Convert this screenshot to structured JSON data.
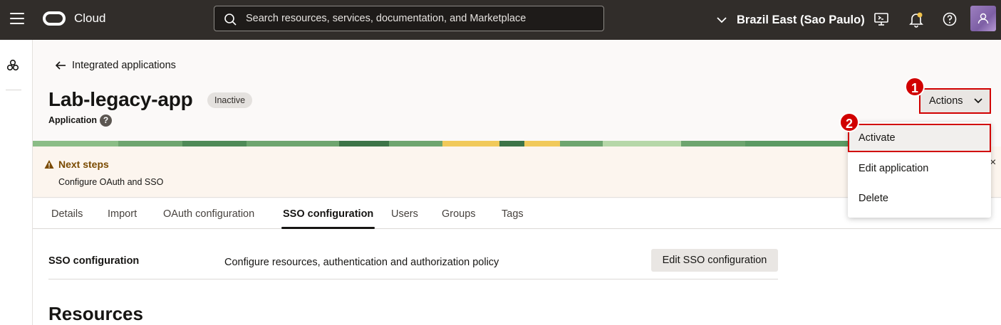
{
  "topbar": {
    "brand": "Cloud",
    "search_placeholder": "Search resources, services, documentation, and Marketplace",
    "region": "Brazil East (Sao Paulo)"
  },
  "header": {
    "back_label": "Integrated applications",
    "title": "Lab-legacy-app",
    "status": "Inactive",
    "subtitle": "Application",
    "help": "?"
  },
  "actions": {
    "label": "Actions",
    "marker_1": "1",
    "marker_2": "2",
    "menu": [
      "Activate",
      "Edit application",
      "Delete"
    ]
  },
  "notice": {
    "title": "Next steps",
    "text": "Configure OAuth and SSO",
    "close": "×"
  },
  "tabs": [
    "Details",
    "Import",
    "OAuth configuration",
    "SSO configuration",
    "Users",
    "Groups",
    "Tags"
  ],
  "selected_tab": "SSO configuration",
  "sso": {
    "label": "SSO configuration",
    "description": "Configure resources, authentication and authorization policy",
    "button": "Edit SSO configuration"
  },
  "section_title": "Resources",
  "colors": {
    "topbar": "#312d2a",
    "highlight": "#d10000",
    "notice_bg": "#fcf5ee",
    "banner_green": "#5c9a63"
  }
}
